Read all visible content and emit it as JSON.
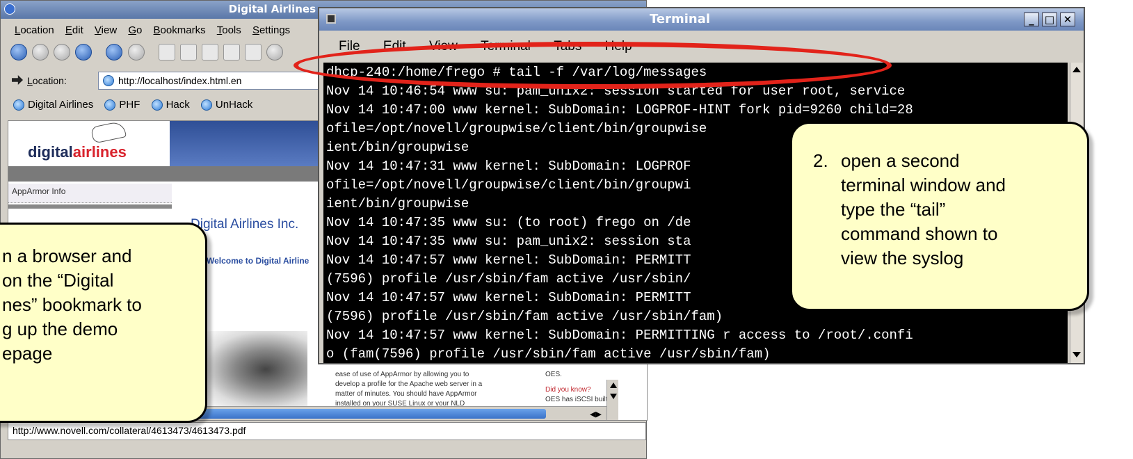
{
  "browser": {
    "title": "Digital Airlines",
    "menu": [
      "Location",
      "Edit",
      "View",
      "Go",
      "Bookmarks",
      "Tools",
      "Settings"
    ],
    "location_label": "Location:",
    "url": "http://localhost/index.html.en",
    "bookmarks": [
      "Digital Airlines",
      "PHF",
      "Hack",
      "UnHack"
    ],
    "logo_text_dark": "digital",
    "logo_text_red": "airlines",
    "side_info": "AppArmor Info",
    "company_heading": "Digital Airlines Inc.",
    "welcome": "Welcome to Digital Airline",
    "col2_lines": [
      "ease of use of AppArmor by allowing you to",
      "develop a profile for the Apache web server in a",
      "matter of minutes. You should have AppArmor",
      "installed on your SUSE Linux or your NLD"
    ],
    "col3_oes": "OES.",
    "col3_did_you_know": "Did you know?",
    "col3_iscsi": "OES has iSCSI built in.",
    "status_url": "http://www.novell.com/collateral/4613473/4613473.pdf"
  },
  "terminal": {
    "title": "Terminal",
    "menu": [
      "File",
      "Edit",
      "View",
      "Terminal",
      "Tabs",
      "Help"
    ],
    "lines": [
      "dhcp-240:/home/frego # tail -f /var/log/messages",
      "Nov 14 10:46:54 www su: pam_unix2: session started for user root, service",
      "Nov 14 10:47:00 www kernel: SubDomain: LOGPROF-HINT fork pid=9260 child=28",
      "ofile=/opt/novell/groupwise/client/bin/groupwise",
      "ient/bin/groupwise",
      "Nov 14 10:47:31 www kernel: SubDomain: LOGPROF",
      "ofile=/opt/novell/groupwise/client/bin/groupwi",
      "ient/bin/groupwise",
      "Nov 14 10:47:35 www su: (to root) frego on /de",
      "Nov 14 10:47:35 www su: pam_unix2: session sta",
      "Nov 14 10:47:57 www kernel: SubDomain: PERMITT",
      "(7596) profile /usr/sbin/fam active /usr/sbin/",
      "Nov 14 10:47:57 www kernel: SubDomain: PERMITT",
      "(7596) profile /usr/sbin/fam active /usr/sbin/fam)",
      "Nov 14 10:47:57 www kernel: SubDomain: PERMITTING r access to /root/.confi",
      "o (fam(7596) profile /usr/sbin/fam active /usr/sbin/fam)"
    ]
  },
  "callouts": {
    "right": {
      "number": "2.",
      "lines": [
        "open a second",
        "terminal window and",
        "type the “tail”",
        "command shown to",
        "view the syslog"
      ]
    },
    "left": {
      "lines": [
        "n a browser and",
        "on the “Digital",
        "nes” bookmark to",
        "g up the demo",
        "epage"
      ]
    }
  },
  "colors": {
    "highlight": "#e2231a",
    "callout_bg": "#ffffc8",
    "terminal_bg": "#000000",
    "brand_red": "#d9232d"
  }
}
